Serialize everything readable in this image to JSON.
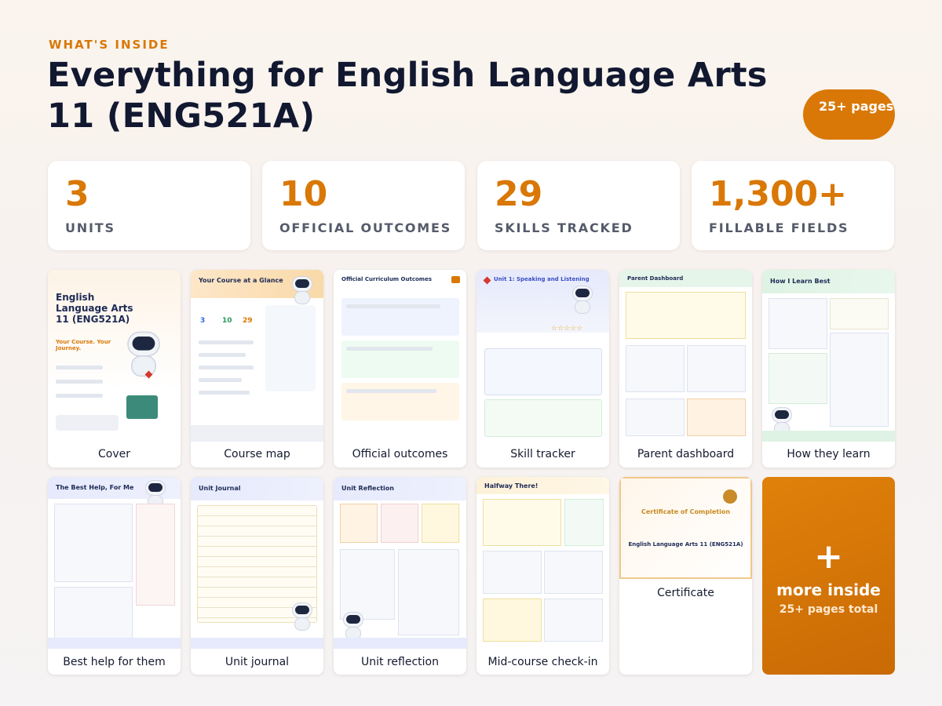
{
  "header": {
    "eyebrow": "WHAT'S INSIDE",
    "title": "Everything for English Language Arts 11 (ENG521A)",
    "pages_badge": "25+ pages"
  },
  "stats": [
    {
      "value": "3",
      "label": "UNITS"
    },
    {
      "value": "10",
      "label": "OFFICIAL OUTCOMES"
    },
    {
      "value": "29",
      "label": "SKILLS TRACKED"
    },
    {
      "value": "1,300+",
      "label": "FILLABLE FIELDS"
    }
  ],
  "cards": [
    {
      "caption": "Cover",
      "thumb_title": "English Language Arts 11 (ENG521A)",
      "thumb_sub": "Your Course. Your Journey."
    },
    {
      "caption": "Course map",
      "thumb_title": "Your Course at a Glance",
      "thumb_stats": [
        "3",
        "10",
        "29"
      ]
    },
    {
      "caption": "Official outcomes",
      "thumb_title": "Official Curriculum Outcomes"
    },
    {
      "caption": "Skill tracker",
      "thumb_title": "Unit 1: Speaking and Listening"
    },
    {
      "caption": "Parent dashboard",
      "thumb_title": "Parent Dashboard"
    },
    {
      "caption": "How they learn",
      "thumb_title": "How I Learn Best"
    },
    {
      "caption": "Best help for them",
      "thumb_title": "The Best Help, For Me"
    },
    {
      "caption": "Unit journal",
      "thumb_title": "Unit Journal"
    },
    {
      "caption": "Unit reflection",
      "thumb_title": "Unit Reflection"
    },
    {
      "caption": "Mid-course check-in",
      "thumb_title": "Halfway There!"
    },
    {
      "caption": "Certificate",
      "thumb_title": "Certificate of Completion",
      "thumb_sub": "English Language Arts 11 (ENG521A)"
    }
  ],
  "more": {
    "plus": "+",
    "label": "more inside",
    "sub": "25+ pages total"
  },
  "colors": {
    "accent": "#d97806",
    "title": "#111830",
    "stat_label": "#555b6a"
  }
}
